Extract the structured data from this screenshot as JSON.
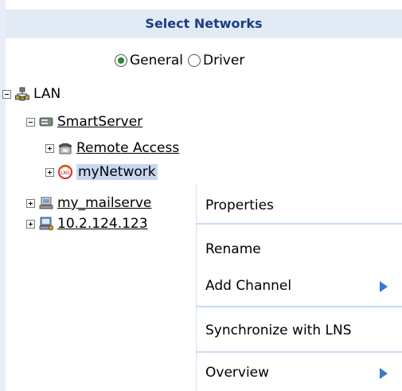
{
  "title": "Select Networks",
  "radio": {
    "general_label": "General",
    "driver_label": "Driver",
    "selected": "General"
  },
  "tree": {
    "root": "LAN",
    "smartserver": "SmartServer",
    "remote_access": "Remote Access",
    "mynetwork": "myNetwork",
    "mailserver": "my_mailserve",
    "ip_node": "10.2.124.123"
  },
  "context_menu": {
    "properties": "Properties",
    "rename": "Rename",
    "add_channel": "Add Channel",
    "synchronize": "Synchronize with LNS",
    "overview": "Overview"
  },
  "icons": [
    "lan-icon",
    "server-icon",
    "phone-icon",
    "lns-network-icon",
    "computer-icon",
    "computer-network-icon"
  ],
  "colors": {
    "title_bg": "#e2eaf5",
    "title_text": "#1b3d80",
    "selection": "#c7d6f1",
    "menu_arrow": "#3a78d4"
  }
}
